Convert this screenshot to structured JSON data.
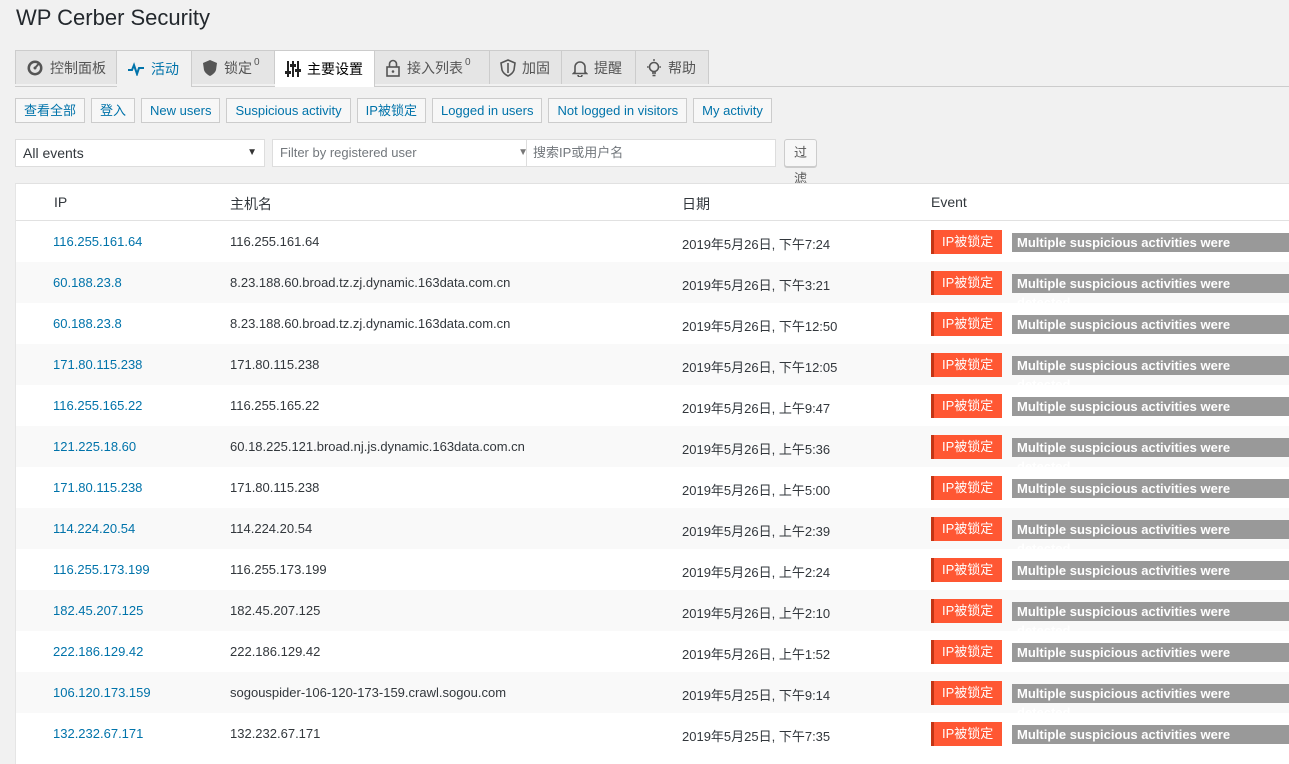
{
  "app_title": "WP Cerber Security",
  "tabs": [
    {
      "label": "控制面板",
      "count": ""
    },
    {
      "label": "活动",
      "count": ""
    },
    {
      "label": "锁定",
      "count": "0"
    },
    {
      "label": "主要设置",
      "count": ""
    },
    {
      "label": "接入列表",
      "count": "0"
    },
    {
      "label": "加固",
      "count": ""
    },
    {
      "label": "提醒",
      "count": ""
    },
    {
      "label": "帮助",
      "count": ""
    }
  ],
  "filter_links": [
    "查看全部",
    "登入",
    "New users",
    "Suspicious activity",
    "IP被锁定",
    "Logged in users",
    "Not logged in visitors",
    "My activity"
  ],
  "filters": {
    "event_select": "All events",
    "user_select": "Filter by registered user",
    "search_placeholder": "搜索IP或用户名",
    "button": "过滤"
  },
  "table": {
    "headers": {
      "ip": "IP",
      "host": "主机名",
      "date": "日期",
      "event": "Event"
    },
    "rows": [
      {
        "ip": "116.255.161.64",
        "host": "116.255.161.64",
        "date": "2019年5月26日, 下午7:24",
        "badge": "IP被锁定",
        "event": "Multiple suspicious activities were detected"
      },
      {
        "ip": "60.188.23.8",
        "host": "8.23.188.60.broad.tz.zj.dynamic.163data.com.cn",
        "date": "2019年5月26日, 下午3:21",
        "badge": "IP被锁定",
        "event": "Multiple suspicious activities were detected"
      },
      {
        "ip": "60.188.23.8",
        "host": "8.23.188.60.broad.tz.zj.dynamic.163data.com.cn",
        "date": "2019年5月26日, 下午12:50",
        "badge": "IP被锁定",
        "event": "Multiple suspicious activities were detected"
      },
      {
        "ip": "171.80.115.238",
        "host": "171.80.115.238",
        "date": "2019年5月26日, 下午12:05",
        "badge": "IP被锁定",
        "event": "Multiple suspicious activities were detected"
      },
      {
        "ip": "116.255.165.22",
        "host": "116.255.165.22",
        "date": "2019年5月26日, 上午9:47",
        "badge": "IP被锁定",
        "event": "Multiple suspicious activities were detected"
      },
      {
        "ip": "121.225.18.60",
        "host": "60.18.225.121.broad.nj.js.dynamic.163data.com.cn",
        "date": "2019年5月26日, 上午5:36",
        "badge": "IP被锁定",
        "event": "Multiple suspicious activities were detected"
      },
      {
        "ip": "171.80.115.238",
        "host": "171.80.115.238",
        "date": "2019年5月26日, 上午5:00",
        "badge": "IP被锁定",
        "event": "Multiple suspicious activities were detected"
      },
      {
        "ip": "114.224.20.54",
        "host": "114.224.20.54",
        "date": "2019年5月26日, 上午2:39",
        "badge": "IP被锁定",
        "event": "Multiple suspicious activities were detected"
      },
      {
        "ip": "116.255.173.199",
        "host": "116.255.173.199",
        "date": "2019年5月26日, 上午2:24",
        "badge": "IP被锁定",
        "event": "Multiple suspicious activities were detected"
      },
      {
        "ip": "182.45.207.125",
        "host": "182.45.207.125",
        "date": "2019年5月26日, 上午2:10",
        "badge": "IP被锁定",
        "event": "Multiple suspicious activities were detected"
      },
      {
        "ip": "222.186.129.42",
        "host": "222.186.129.42",
        "date": "2019年5月26日, 上午1:52",
        "badge": "IP被锁定",
        "event": "Multiple suspicious activities were detected"
      },
      {
        "ip": "106.120.173.159",
        "host": "sogouspider-106-120-173-159.crawl.sogou.com",
        "date": "2019年5月25日, 下午9:14",
        "badge": "IP被锁定",
        "event": "Multiple suspicious activities were detected"
      },
      {
        "ip": "132.232.67.171",
        "host": "132.232.67.171",
        "date": "2019年5月25日, 下午7:35",
        "badge": "IP被锁定",
        "event": "Multiple suspicious activities were detected"
      }
    ]
  },
  "colors": {
    "link": "#0073aa",
    "badge": "#ff5733",
    "event_tag": "#999999"
  }
}
